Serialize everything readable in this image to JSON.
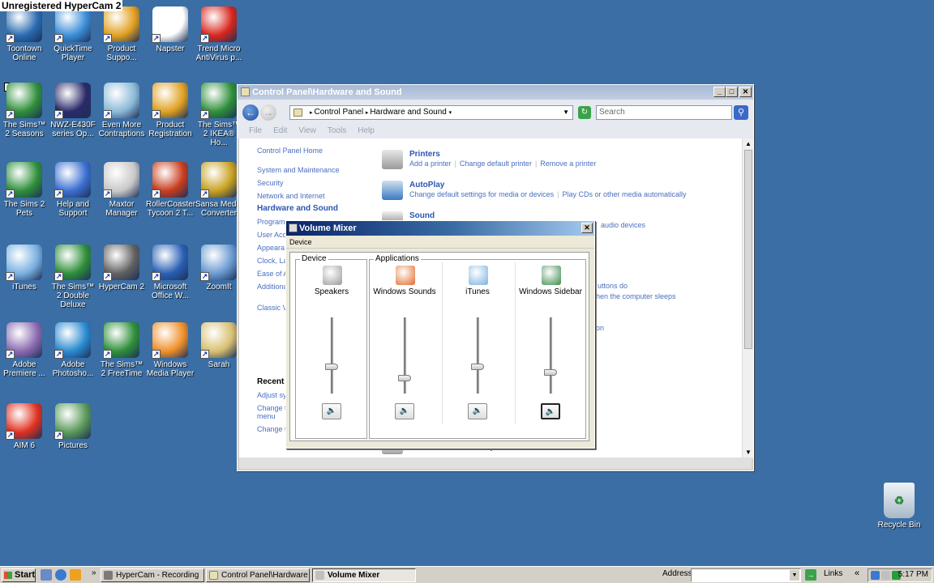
{
  "watermark": "Unregistered HyperCam 2",
  "colors": {
    "desktop": "#3a6ea5",
    "link_blue": "#4a6fbf",
    "title_active": "#0a246a"
  },
  "desktop_icons": [
    {
      "label": "Toontown Online",
      "icon": "toontown-icon",
      "color": "#2a6bb0"
    },
    {
      "label": "QuickTime Player",
      "icon": "quicktime-icon",
      "color": "#3c8ed8"
    },
    {
      "label": "Product Suppo...",
      "icon": "chrome-icon",
      "color": "#e0a020"
    },
    {
      "label": "Napster",
      "icon": "napster-icon",
      "color": "#ffffff"
    },
    {
      "label": "Trend Micro AntiVirus p...",
      "icon": "trend-micro-icon",
      "color": "#d8261c"
    },
    {
      "label": "The Sims™ 2 Seasons",
      "icon": "sims2-seasons-icon",
      "color": "#2f8f3a"
    },
    {
      "label": "NWZ-E430F series Op...",
      "icon": "pdf-document-icon",
      "color": "#2a2a6a"
    },
    {
      "label": "Even More Contraptions",
      "icon": "contraptions-icon",
      "color": "#8bbad8"
    },
    {
      "label": "Product Registration",
      "icon": "chrome-icon",
      "color": "#e0a020"
    },
    {
      "label": "The Sims™ 2 IKEA® Ho...",
      "icon": "sims2-ikea-icon",
      "color": "#2f8f3a"
    },
    {
      "label": "The Sims 2 Pets",
      "icon": "sims2-pets-icon",
      "color": "#2f8f3a"
    },
    {
      "label": "Help and Support",
      "icon": "help-icon",
      "color": "#3b6fd0"
    },
    {
      "label": "Maxtor Manager",
      "icon": "maxtor-icon",
      "color": "#c8c8c8"
    },
    {
      "label": "RollerCoaster Tycoon 2 T...",
      "icon": "rollercoaster-icon",
      "color": "#c83c1c"
    },
    {
      "label": "Sansa Media Converter",
      "icon": "sansa-icon",
      "color": "#c8a020"
    },
    {
      "label": "iTunes",
      "icon": "itunes-icon",
      "color": "#7ab0e0"
    },
    {
      "label": "The Sims™ 2 Double Deluxe",
      "icon": "sims2-deluxe-icon",
      "color": "#2f8f3a"
    },
    {
      "label": "HyperCam 2",
      "icon": "hypercam-icon",
      "color": "#606060"
    },
    {
      "label": "Microsoft Office W...",
      "icon": "word-icon",
      "color": "#2a5fb4"
    },
    {
      "label": "ZoomIt",
      "icon": "zoomit-icon",
      "color": "#6a9ad0"
    },
    {
      "label": "Adobe Premiere ...",
      "icon": "premiere-icon",
      "color": "#8a6ab0"
    },
    {
      "label": "Adobe Photosho...",
      "icon": "photoshop-icon",
      "color": "#2a8ad0"
    },
    {
      "label": "The Sims™ 2 FreeTime",
      "icon": "sims2-freetime-icon",
      "color": "#2f8f3a"
    },
    {
      "label": "Windows Media Player",
      "icon": "media-player-icon",
      "color": "#f0902a"
    },
    {
      "label": "Sarah",
      "icon": "folder-icon",
      "color": "#d8c070"
    },
    {
      "label": "AIM 6",
      "icon": "aim-icon",
      "color": "#e03020"
    },
    {
      "label": "Pictures",
      "icon": "pictures-folder-icon",
      "color": "#5a9a5a"
    }
  ],
  "recycle_bin": {
    "label": "Recycle Bin",
    "icon": "recycle-bin-icon"
  },
  "control_panel": {
    "title": "Control Panel\\Hardware and Sound",
    "breadcrumb": [
      "Control Panel",
      "Hardware and Sound"
    ],
    "search_placeholder": "Search",
    "menu": [
      "File",
      "Edit",
      "View",
      "Tools",
      "Help"
    ],
    "left_nav": {
      "home": "Control Panel Home",
      "items": [
        "System and Maintenance",
        "Security",
        "Network and Internet"
      ],
      "current": "Hardware and Sound",
      "partial": [
        "Programs",
        "User Acc",
        "Appeara",
        "Clock, La",
        "Ease of A",
        "Additiona"
      ],
      "classic": "Classic Vi",
      "recent_heading": "Recent",
      "recent": [
        "Adjust sy",
        "Change t",
        "menu",
        "Change t"
      ]
    },
    "sections": [
      {
        "name": "Printers",
        "icon": "printer-icon",
        "links": [
          "Add a printer",
          "Change default printer",
          "Remove a printer"
        ]
      },
      {
        "name": "AutoPlay",
        "icon": "autoplay-icon",
        "links": [
          "Change default settings for media or devices",
          "Play CDs or other media automatically"
        ]
      },
      {
        "name": "Sound",
        "icon": "sound-icon",
        "links": []
      }
    ],
    "fragments": [
      "audio devices",
      "uttons do",
      "hen the computer sleeps",
      "on",
      "Phone and Modem Options"
    ]
  },
  "volume_mixer": {
    "title": "Volume Mixer",
    "menu": "Device",
    "device_group": "Device",
    "apps_group": "Applications",
    "channels": [
      {
        "name": "Speakers",
        "icon": "speakers-icon",
        "level": 0.35
      },
      {
        "name": "Windows Sounds",
        "icon": "windows-logo-icon",
        "level": 0.2
      },
      {
        "name": "iTunes",
        "icon": "itunes-icon",
        "level": 0.35
      },
      {
        "name": "Windows Sidebar",
        "icon": "sidebar-icon",
        "level": 0.28
      }
    ]
  },
  "taskbar": {
    "start": "Start",
    "buttons": [
      {
        "label": "HyperCam - Recording",
        "icon": "hypercam-icon"
      },
      {
        "label": "Control Panel\\Hardware ...",
        "icon": "control-panel-icon"
      },
      {
        "label": "Volume Mixer",
        "icon": "speakers-icon"
      }
    ],
    "address_label": "Address",
    "links_label": "Links",
    "chevron": "«",
    "clock": "5:17 PM"
  }
}
